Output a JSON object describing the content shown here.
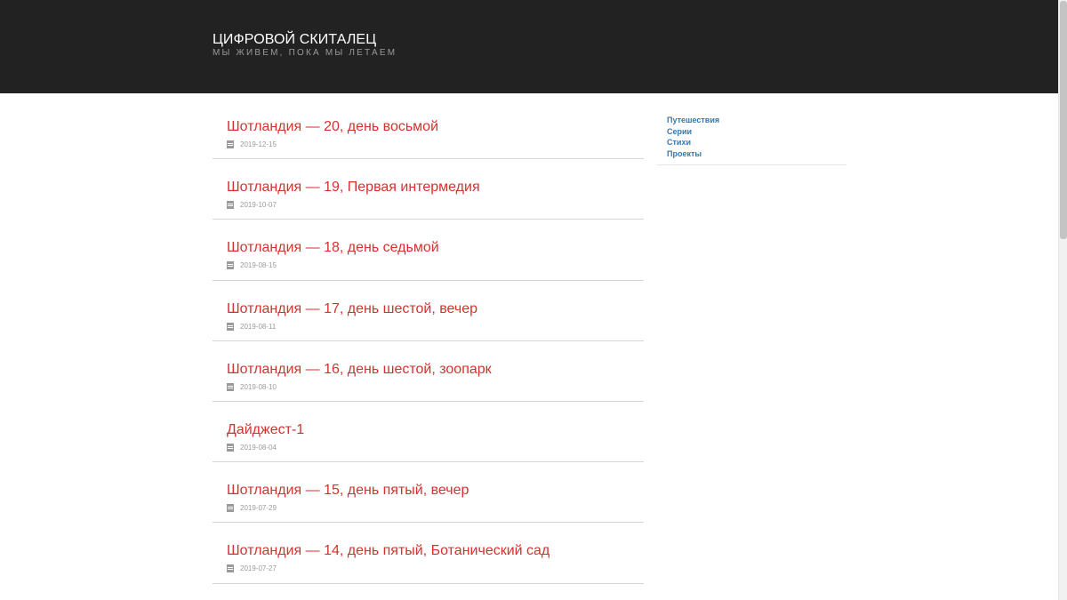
{
  "header": {
    "title": "ЦИФРОВОЙ СКИТАЛЕЦ",
    "tagline": "МЫ ЖИВЕМ, ПОКА МЫ ЛЕТАЕМ"
  },
  "posts": [
    {
      "title": "Шотландия — 20, день восьмой",
      "date": "2019-12-15"
    },
    {
      "title": "Шотландия — 19, Первая интермедия",
      "date": "2019-10-07"
    },
    {
      "title": "Шотландия — 18, день седьмой",
      "date": "2019-08-15"
    },
    {
      "title": "Шотландия — 17, день шестой, вечер",
      "date": "2019-08-11"
    },
    {
      "title": "Шотландия — 16, день шестой, зоопарк",
      "date": "2019-08-10"
    },
    {
      "title": "Дайджест-1",
      "date": "2019-08-04"
    },
    {
      "title": "Шотландия — 15, день пятый, вечер",
      "date": "2019-07-29"
    },
    {
      "title": "Шотландия — 14, день пятый, Ботанический сад",
      "date": "2019-07-27"
    }
  ],
  "sidebar": {
    "categories": [
      {
        "label": "Путешествия"
      },
      {
        "label": "Серии"
      },
      {
        "label": "Стихи"
      },
      {
        "label": "Проекты"
      }
    ]
  },
  "colors": {
    "header_bg": "#222222",
    "post_title": "#d4322e",
    "sidebar_link": "#3178b4",
    "meta_text": "#9a9a9a"
  },
  "icons": {
    "post_meta": "calendar-icon"
  }
}
